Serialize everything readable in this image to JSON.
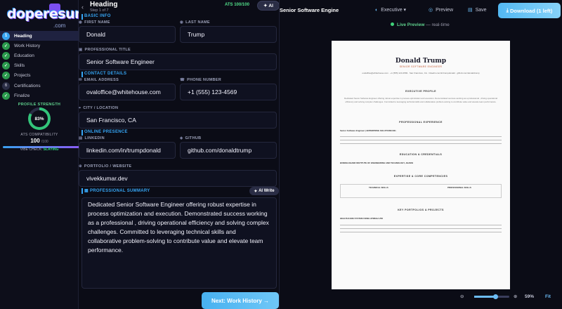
{
  "brand": {
    "logo_text": "doperesume",
    "logo_sub": ".com"
  },
  "steps": [
    {
      "num": "1",
      "label": "Heading",
      "state": "active"
    },
    {
      "num": "✓",
      "label": "Work History",
      "state": "done"
    },
    {
      "num": "✓",
      "label": "Education",
      "state": "done"
    },
    {
      "num": "✓",
      "label": "Skills",
      "state": "done"
    },
    {
      "num": "✓",
      "label": "Projects",
      "state": "done"
    },
    {
      "num": "6",
      "label": "Certifications",
      "state": "pending"
    },
    {
      "num": "✓",
      "label": "Finalize",
      "state": "done"
    }
  ],
  "strength": {
    "title": "PROFILE STRENGTH",
    "percent": "83%",
    "value": 0.83
  },
  "ats": {
    "title": "ATS COMPATIBILITY",
    "score": "100",
    "max": "/100"
  },
  "vibe": {
    "label": "VIBE CHECK:",
    "value": "SLAYING"
  },
  "form": {
    "title": "Heading",
    "step": "Step 1 of 7",
    "ats_badge": "ATS 100/100",
    "ai_label": "AI",
    "sections": {
      "basic": "BASIC INFO",
      "contact": "CONTACT DETAILS",
      "online": "ONLINE PRESENCE",
      "summary": "PROFESSIONAL SUMMARY"
    },
    "labels": {
      "first_name": "FIRST NAME",
      "last_name": "LAST NAME",
      "title": "PROFESSIONAL TITLE",
      "email": "EMAIL ADDRESS",
      "phone": "PHONE NUMBER",
      "city": "CITY / LOCATION",
      "linkedin": "LINKEDIN",
      "github": "GITHUB",
      "portfolio": "PORTFOLIO / WEBSITE"
    },
    "values": {
      "first_name": "Donald",
      "last_name": "Trump",
      "title": "Senior Software Engineer",
      "email": "ovaloffice@whitehouse.com",
      "phone": "+1 (555) 123-4569",
      "city": "San Francisco, CA",
      "linkedin": "linkedin.com/in/trumpdonald",
      "github": "github.com/donaldtrump",
      "portfolio": "vivekkumar.dev",
      "summary": "Dedicated Senior Software Engineer offering robust expertise in process optimization and execution. Demonstrated success working as a professional , driving operational efficiency and solving complex challenges. Committed to leveraging technical skills and collaborative problem-solving to contribute value and elevate team performance."
    },
    "ai_write": "AI Write",
    "next_button": "Next: Work History →"
  },
  "topbar": {
    "doc_title": "Senior Software Engine",
    "template": "Executive",
    "preview": "Preview",
    "save": "Save",
    "download": "Download (1 left)",
    "live": "Live Preview",
    "realtime": "— real-time"
  },
  "resume": {
    "name": "Donald Trump",
    "title": "SENIOR SOFTWARE ENGINEER",
    "contact": "ovaloffice@whitehouse.com · +1 (555) 123-4569 · San Francisco, CA · linkedin.com/in/trumpdonald · github.com/donaldtrump",
    "sections": [
      "EXECUTIVE PROFILE",
      "PROFESSIONAL EXPERIENCE",
      "EDUCATION & CREDENTIALS",
      "EXPERTISE & CORE COMPETENCIES",
      "KEY PORTFOLIOS & PROJECTS"
    ],
    "exp_role": "Senior Software Engineer | ENTERPRISE SOLUTIONS INC.",
    "edu": "BUNDELKHAND INSTITUTE OF ENGINEERING AND TECHNOLOGY, JHANSI",
    "project": "HEALTHCARE SYSTEM USING ATMEGA 258",
    "tech_skills": "TECHNICAL SKILLS",
    "pro_skills": "PROFESSIONAL SKILLS"
  },
  "zoom": {
    "percent": "59%",
    "fit": "Fit",
    "level": 0.59
  },
  "colors": {
    "accent": "#36a6f5",
    "success": "#2b9a4d",
    "download": "#53b8f2"
  }
}
